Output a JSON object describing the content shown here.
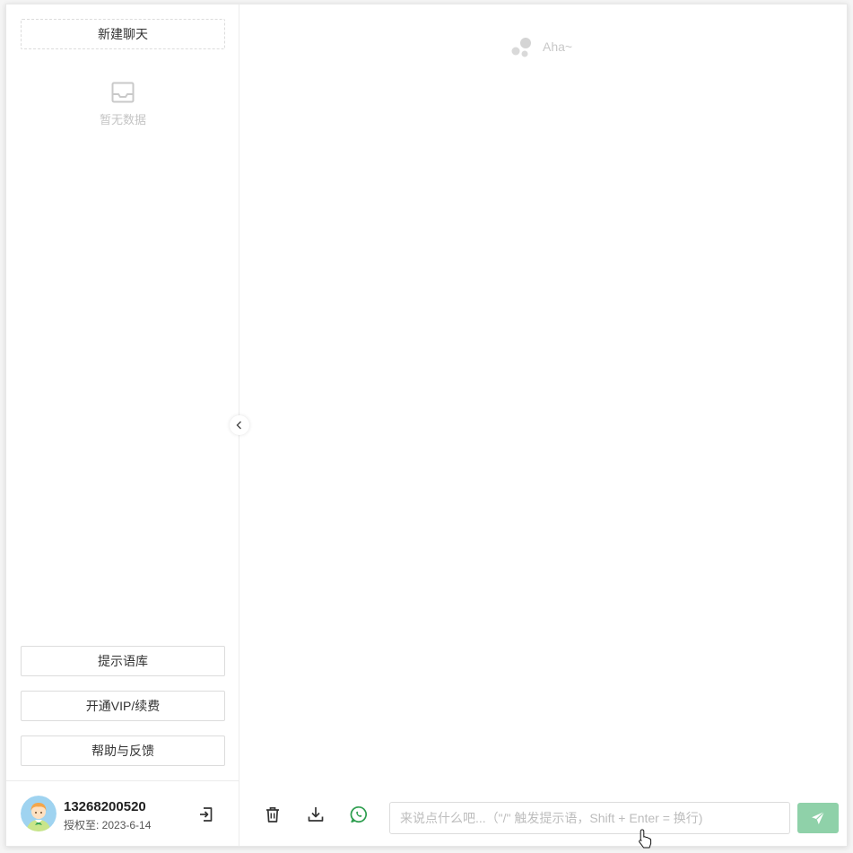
{
  "sidebar": {
    "new_chat_label": "新建聊天",
    "empty_text": "暂无数据",
    "prompt_library_label": "提示语库",
    "vip_label": "开通VIP/续费",
    "help_label": "帮助与反馈"
  },
  "user": {
    "phone": "13268200520",
    "expire_text": "授权至: 2023-6-14"
  },
  "main": {
    "brand_text": "Aha~"
  },
  "composer": {
    "placeholder": "来说点什么吧...（\"/\" 触发提示语，Shift + Enter = 换行)",
    "value": ""
  },
  "icons": {
    "empty": "inbox-icon",
    "logout": "logout-icon",
    "collapse": "chevron-left-icon",
    "trash": "trash-icon",
    "download": "download-icon",
    "whatsapp": "whatsapp-icon",
    "send": "send-icon",
    "brand": "dots-logo-icon"
  },
  "colors": {
    "send_button": "#8fd1a9",
    "whatsapp_green": "#2e9e4f",
    "muted_text": "#c4c4c4"
  }
}
